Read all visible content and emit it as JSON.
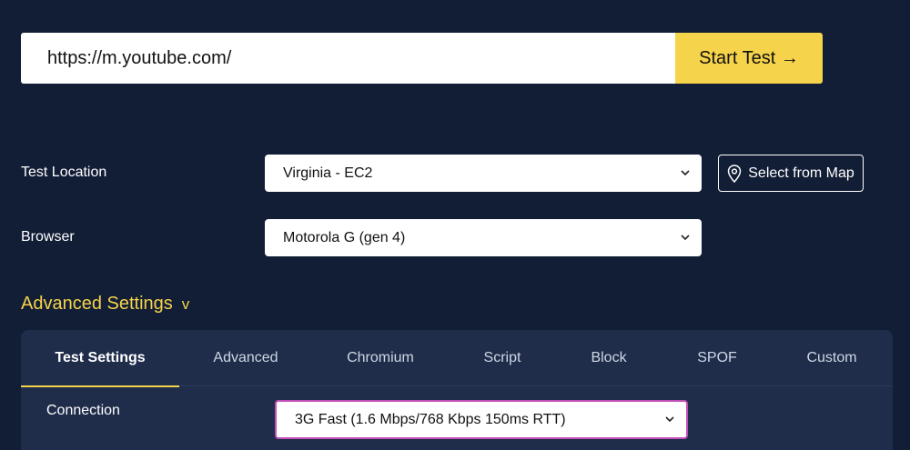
{
  "url_bar": {
    "value": "https://m.youtube.com/",
    "start_button_label": "Start Test →"
  },
  "location": {
    "label": "Test Location",
    "selected": "Virginia - EC2",
    "map_button_label": "Select from Map"
  },
  "browser": {
    "label": "Browser",
    "selected": "Motorola G (gen 4)"
  },
  "advanced": {
    "toggle_label": "Advanced Settings",
    "toggle_indicator": "v",
    "tabs": [
      {
        "label": "Test Settings",
        "active": true
      },
      {
        "label": "Advanced",
        "active": false
      },
      {
        "label": "Chromium",
        "active": false
      },
      {
        "label": "Script",
        "active": false
      },
      {
        "label": "Block",
        "active": false
      },
      {
        "label": "SPOF",
        "active": false
      },
      {
        "label": "Custom",
        "active": false
      }
    ],
    "connection": {
      "label": "Connection",
      "selected": "3G Fast (1.6 Mbps/768 Kbps 150ms RTT)"
    }
  },
  "colors": {
    "background": "#121d36",
    "accent": "#f5d34a",
    "panel": "#1f2d4b",
    "focus_border": "#c24fb7"
  },
  "icons": {
    "select_arrow": "chevron-down-icon",
    "map_button": "map-pin-icon",
    "start_arrow": "arrow-right-icon"
  }
}
